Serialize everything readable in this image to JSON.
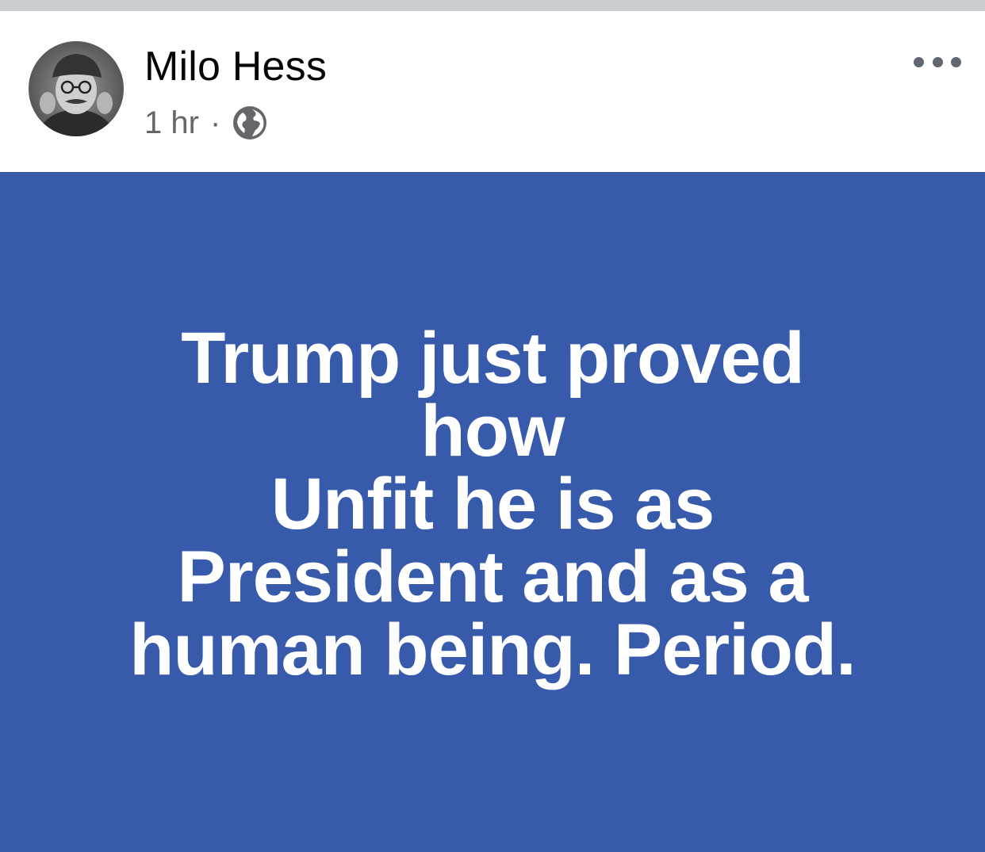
{
  "post": {
    "author": "Milo Hess",
    "time": "1 hr",
    "separator": "·",
    "privacy_icon": "globe-icon",
    "more_icon": "more-options-icon",
    "text_lines": [
      "Trump just proved",
      "how",
      "Unfit he is as",
      "President and as a",
      "human being. Period."
    ],
    "background_color": "#375aab",
    "text_color": "#ffffff"
  }
}
